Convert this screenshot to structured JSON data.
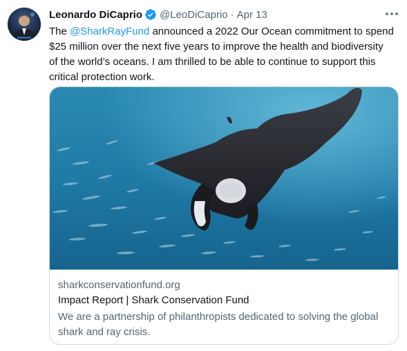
{
  "tweet": {
    "author_name": "Leonardo DiCaprio",
    "author_handle": "@LeoDiCaprio",
    "separator": "·",
    "timestamp": "Apr 13",
    "verified_icon": "verified-badge-icon",
    "more_icon": "more-options-icon",
    "text_prefix": "The ",
    "mention": "@SharkRayFund",
    "text_suffix": " announced a 2022 Our Ocean commitment to spend $25 million over the next five years to improve the health and biodiversity of the world’s oceans. I am thrilled to be able to continue to support this critical protection work."
  },
  "card": {
    "domain": "sharkconservationfund.org",
    "title": "Impact Report | Shark Conservation Fund",
    "description": "We are a partnership of philanthropists dedicated to solving the global shark and ray crisis."
  },
  "colors": {
    "accent": "#1d9bf0",
    "text": "#0f1419",
    "secondary": "#536471",
    "border": "#cfd9de"
  }
}
